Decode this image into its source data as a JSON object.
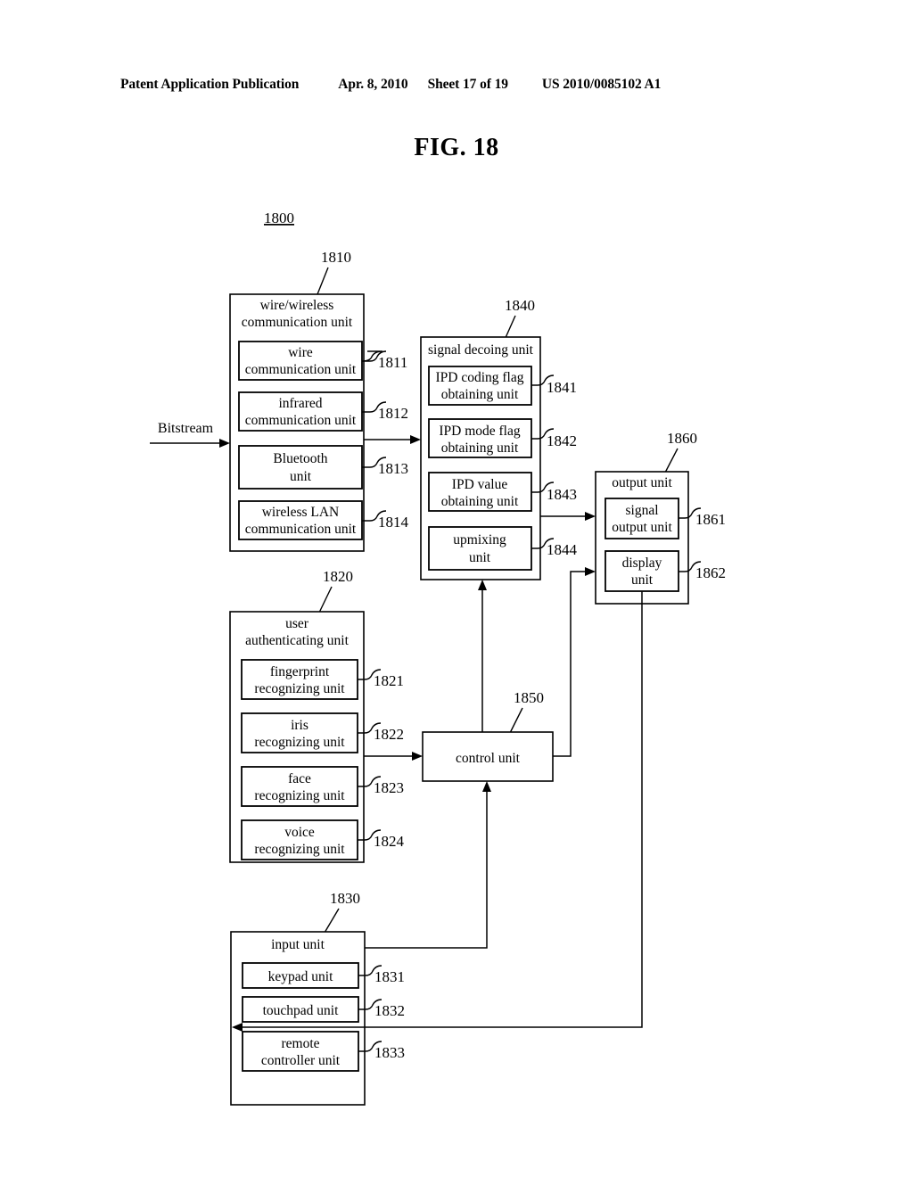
{
  "header": {
    "publication": "Patent Application Publication",
    "date": "Apr. 8, 2010",
    "sheet": "Sheet 17 of 19",
    "patent_number": "US 2010/0085102 A1"
  },
  "figure": {
    "title": "FIG. 18",
    "system_ref": "1800",
    "input_signal_label": "Bitstream"
  },
  "blocks": {
    "comm": {
      "ref": "1810",
      "title_line1": "wire/wireless",
      "title_line2": "communication unit",
      "children": [
        {
          "ref": "1811",
          "line1": "wire",
          "line2": "communication unit"
        },
        {
          "ref": "1812",
          "line1": "infrared",
          "line2": "communication unit"
        },
        {
          "ref": "1813",
          "line1": "Bluetooth",
          "line2": "unit"
        },
        {
          "ref": "1814",
          "line1": "wireless LAN",
          "line2": "communication unit"
        }
      ]
    },
    "auth": {
      "ref": "1820",
      "title_line1": "user",
      "title_line2": "authenticating unit",
      "children": [
        {
          "ref": "1821",
          "line1": "fingerprint",
          "line2": "recognizing unit"
        },
        {
          "ref": "1822",
          "line1": "iris",
          "line2": "recognizing unit"
        },
        {
          "ref": "1823",
          "line1": "face",
          "line2": "recognizing unit"
        },
        {
          "ref": "1824",
          "line1": "voice",
          "line2": "recognizing unit"
        }
      ]
    },
    "input": {
      "ref": "1830",
      "title_line1": "input unit",
      "title_line2": "",
      "children": [
        {
          "ref": "1831",
          "line1": "keypad unit",
          "line2": ""
        },
        {
          "ref": "1832",
          "line1": "touchpad unit",
          "line2": ""
        },
        {
          "ref": "1833",
          "line1": "remote",
          "line2": "controller unit"
        }
      ]
    },
    "decoder": {
      "ref": "1840",
      "title_line1": "signal decoing unit",
      "title_line2": "",
      "children": [
        {
          "ref": "1841",
          "line1": "IPD coding flag",
          "line2": "obtaining unit"
        },
        {
          "ref": "1842",
          "line1": "IPD mode flag",
          "line2": "obtaining unit"
        },
        {
          "ref": "1843",
          "line1": "IPD value",
          "line2": "obtaining unit"
        },
        {
          "ref": "1844",
          "line1": "upmixing",
          "line2": "unit"
        }
      ]
    },
    "control": {
      "ref": "1850",
      "title_line1": "control unit",
      "title_line2": "",
      "children": []
    },
    "output": {
      "ref": "1860",
      "title_line1": "output unit",
      "title_line2": "",
      "children": [
        {
          "ref": "1861",
          "line1": "signal",
          "line2": "output unit"
        },
        {
          "ref": "1862",
          "line1": "display",
          "line2": "unit"
        }
      ]
    }
  }
}
